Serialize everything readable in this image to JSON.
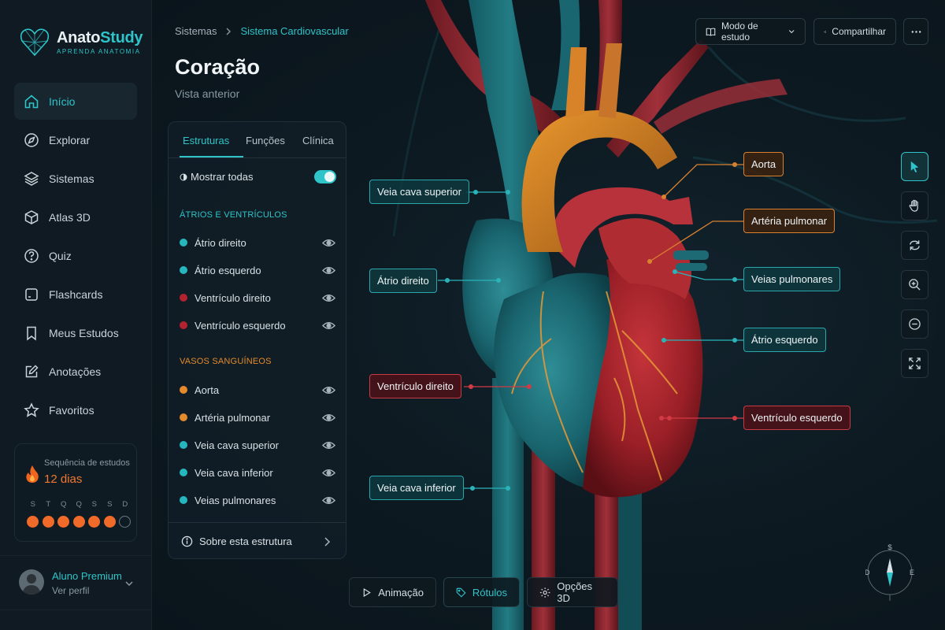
{
  "app": {
    "name_part1": "Anato",
    "name_part2": "Study",
    "tagline": "APRENDA ANATOMIA"
  },
  "sidebar": {
    "items": [
      {
        "label": "Início",
        "icon": "home-icon",
        "active": true
      },
      {
        "label": "Explorar",
        "icon": "compass-icon"
      },
      {
        "label": "Sistemas",
        "icon": "layers-icon"
      },
      {
        "label": "Atlas 3D",
        "icon": "cube-icon"
      },
      {
        "label": "Quiz",
        "icon": "question-icon"
      },
      {
        "label": "Flashcards",
        "icon": "cards-icon"
      },
      {
        "label": "Meus Estudos",
        "icon": "bookmark-icon"
      },
      {
        "label": "Anotações",
        "icon": "edit-icon"
      },
      {
        "label": "Favoritos",
        "icon": "star-icon"
      }
    ],
    "streak": {
      "title": "Sequência de estudos",
      "days": "12 dias",
      "week_labels": [
        "S",
        "T",
        "Q",
        "Q",
        "S",
        "S",
        "D"
      ],
      "week_done": [
        true,
        true,
        true,
        true,
        true,
        true,
        false
      ]
    },
    "profile": {
      "name": "Aluno Premium",
      "sub": "Ver perfil"
    }
  },
  "header": {
    "breadcrumb_root": "Sistemas",
    "breadcrumb_current": "Sistema Cardiovascular",
    "title": "Coração",
    "subtitle": "Vista anterior",
    "study_mode": "Modo de estudo",
    "share": "Compartilhar"
  },
  "panel": {
    "tabs": [
      "Estruturas",
      "Funções",
      "Clínica"
    ],
    "active_tab": "Estruturas",
    "show_all": "Mostrar todas",
    "show_all_on": true,
    "section1": "ÁTRIOS E VENTRÍCULOS",
    "section2": "VASOS SANGUÍNEOS",
    "items1": [
      {
        "label": "Átrio direito",
        "color": "#25b7bd"
      },
      {
        "label": "Átrio esquerdo",
        "color": "#25b7bd"
      },
      {
        "label": "Ventrículo direito",
        "color": "#b3232f"
      },
      {
        "label": "Ventrículo esquerdo",
        "color": "#b3232f"
      }
    ],
    "items2": [
      {
        "label": "Aorta",
        "color": "#e48a2c"
      },
      {
        "label": "Artéria pulmonar",
        "color": "#e48a2c"
      },
      {
        "label": "Veia cava superior",
        "color": "#25b7bd"
      },
      {
        "label": "Veia cava inferior",
        "color": "#25b7bd"
      },
      {
        "label": "Veias pulmonares",
        "color": "#25b7bd"
      }
    ],
    "footer": "Sobre esta estrutura"
  },
  "labels": {
    "aorta": "Aorta",
    "arteria_pulmonar": "Artéria pulmonar",
    "veias_pulmonares": "Veias pulmonares",
    "atrio_esquerdo": "Átrio esquerdo",
    "ventriculo_esquerdo": "Ventrículo esquerdo",
    "veia_cava_superior": "Veia cava superior",
    "atrio_direito": "Átrio direito",
    "ventriculo_direito": "Ventrículo direito",
    "veia_cava_inferior": "Veia cava inferior"
  },
  "bottom": {
    "animation": "Animação",
    "labels": "Rótulos",
    "options3d": "Opções 3D"
  },
  "compass": {
    "n": "S",
    "w": "D",
    "e": "E"
  },
  "colors": {
    "accent": "#2ec4c9",
    "orange": "#e48a2c",
    "red": "#b3232f",
    "streak": "#f06a2a"
  }
}
